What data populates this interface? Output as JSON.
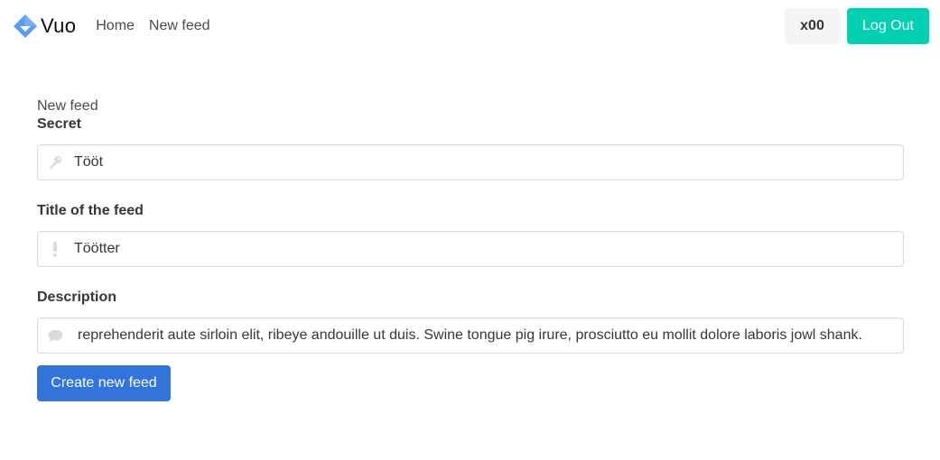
{
  "navbar": {
    "brand_name": "Vuo",
    "links": [
      {
        "label": "Home"
      },
      {
        "label": "New feed"
      }
    ],
    "username": "x00",
    "logout_label": "Log Out",
    "brand_color": "#5b9bf0",
    "logout_color": "#00d1b2"
  },
  "page": {
    "title": "New feed"
  },
  "form": {
    "secret": {
      "label": "Secret",
      "value": "Tööt",
      "icon": "key-icon"
    },
    "title": {
      "label": "Title of the feed",
      "value": "Töötter",
      "icon": "exclamation-icon"
    },
    "description": {
      "label": "Description",
      "value": "reprehenderit aute sirloin elit, ribeye andouille ut duis. Swine tongue pig irure, prosciutto eu mollit dolore laboris jowl shank.",
      "icon": "comment-icon"
    },
    "submit_label": "Create new feed",
    "submit_color": "#3273dc"
  }
}
